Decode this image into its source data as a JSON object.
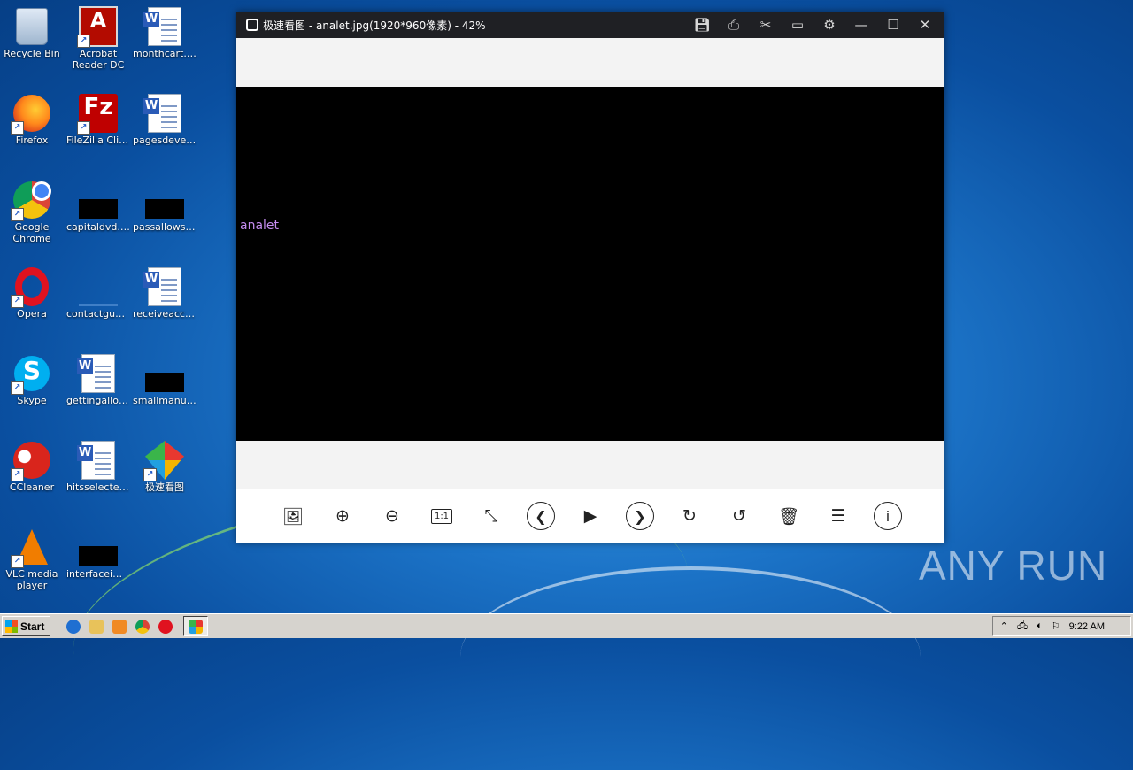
{
  "desktop": {
    "icons": [
      {
        "label": "Recycle Bin",
        "icon": "recycle-bin-icon"
      },
      {
        "label": "Acrobat Reader DC",
        "icon": "acrobat-reader-icon"
      },
      {
        "label": "monthcart.rtf",
        "icon": "word-document-icon"
      },
      {
        "label": "Firefox",
        "icon": "firefox-icon"
      },
      {
        "label": "FileZilla Client",
        "icon": "filezilla-icon"
      },
      {
        "label": "pagesdevel...",
        "icon": "word-document-icon"
      },
      {
        "label": "Google Chrome",
        "icon": "chrome-icon"
      },
      {
        "label": "capitaldvd.jpg",
        "icon": "image-file-icon"
      },
      {
        "label": "passallows.jpg",
        "icon": "image-file-icon"
      },
      {
        "label": "Opera",
        "icon": "opera-icon"
      },
      {
        "label": "contactgue...",
        "icon": "image-file-icon"
      },
      {
        "label": "receiveacco...",
        "icon": "word-document-icon"
      },
      {
        "label": "Skype",
        "icon": "skype-icon"
      },
      {
        "label": "gettingallow...",
        "icon": "word-document-icon"
      },
      {
        "label": "smallmanuf...",
        "icon": "image-file-icon"
      },
      {
        "label": "CCleaner",
        "icon": "ccleaner-icon"
      },
      {
        "label": "hitsselected...",
        "icon": "word-document-icon"
      },
      {
        "label": "极速看图",
        "icon": "image-viewer-icon"
      },
      {
        "label": "VLC media player",
        "icon": "vlc-icon"
      },
      {
        "label": "interfaceima...",
        "icon": "image-file-icon"
      }
    ]
  },
  "viewer": {
    "title": "极速看图 - analet.jpg(1920*960像素) - 42%",
    "image_text": "analet",
    "title_buttons": [
      "save-icon",
      "print-icon",
      "cut-icon",
      "comment-icon",
      "settings-icon",
      "minimize-icon",
      "maximize-icon",
      "close-icon"
    ],
    "toolbar": {
      "one_to_one": "1:1"
    }
  },
  "watermark": "ANY RUN",
  "taskbar": {
    "start_label": "Start",
    "clock": "9:22 AM"
  }
}
